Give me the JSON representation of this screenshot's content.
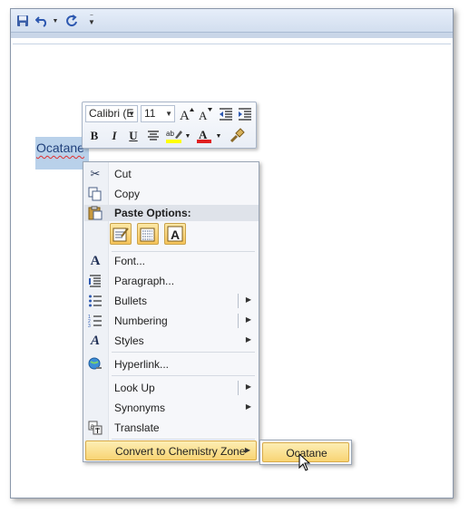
{
  "quick_access": {
    "icons": [
      "save-icon",
      "undo-icon",
      "redo-icon",
      "customize-toolbar-icon"
    ]
  },
  "document": {
    "selected_text": "Ocatane"
  },
  "mini_toolbar": {
    "font_name": "Calibri (E",
    "font_size": "11",
    "bold": "B",
    "italic": "I",
    "underline": "U",
    "font_color_glyph": "A",
    "highlight_color": "#ffff00",
    "font_color": "#e02020"
  },
  "context_menu": {
    "items": {
      "cut": "Cut",
      "copy": "Copy",
      "paste_header": "Paste Options:",
      "font": "Font...",
      "paragraph": "Paragraph...",
      "bullets": "Bullets",
      "numbering": "Numbering",
      "styles": "Styles",
      "hyperlink": "Hyperlink...",
      "look_up": "Look Up",
      "synonyms": "Synonyms",
      "translate": "Translate",
      "convert": "Convert to Chemistry Zone"
    },
    "paste_options": [
      "keep-source-formatting-icon",
      "merge-formatting-icon",
      "keep-text-only-icon"
    ]
  },
  "submenu": {
    "item": "Ocatane"
  }
}
